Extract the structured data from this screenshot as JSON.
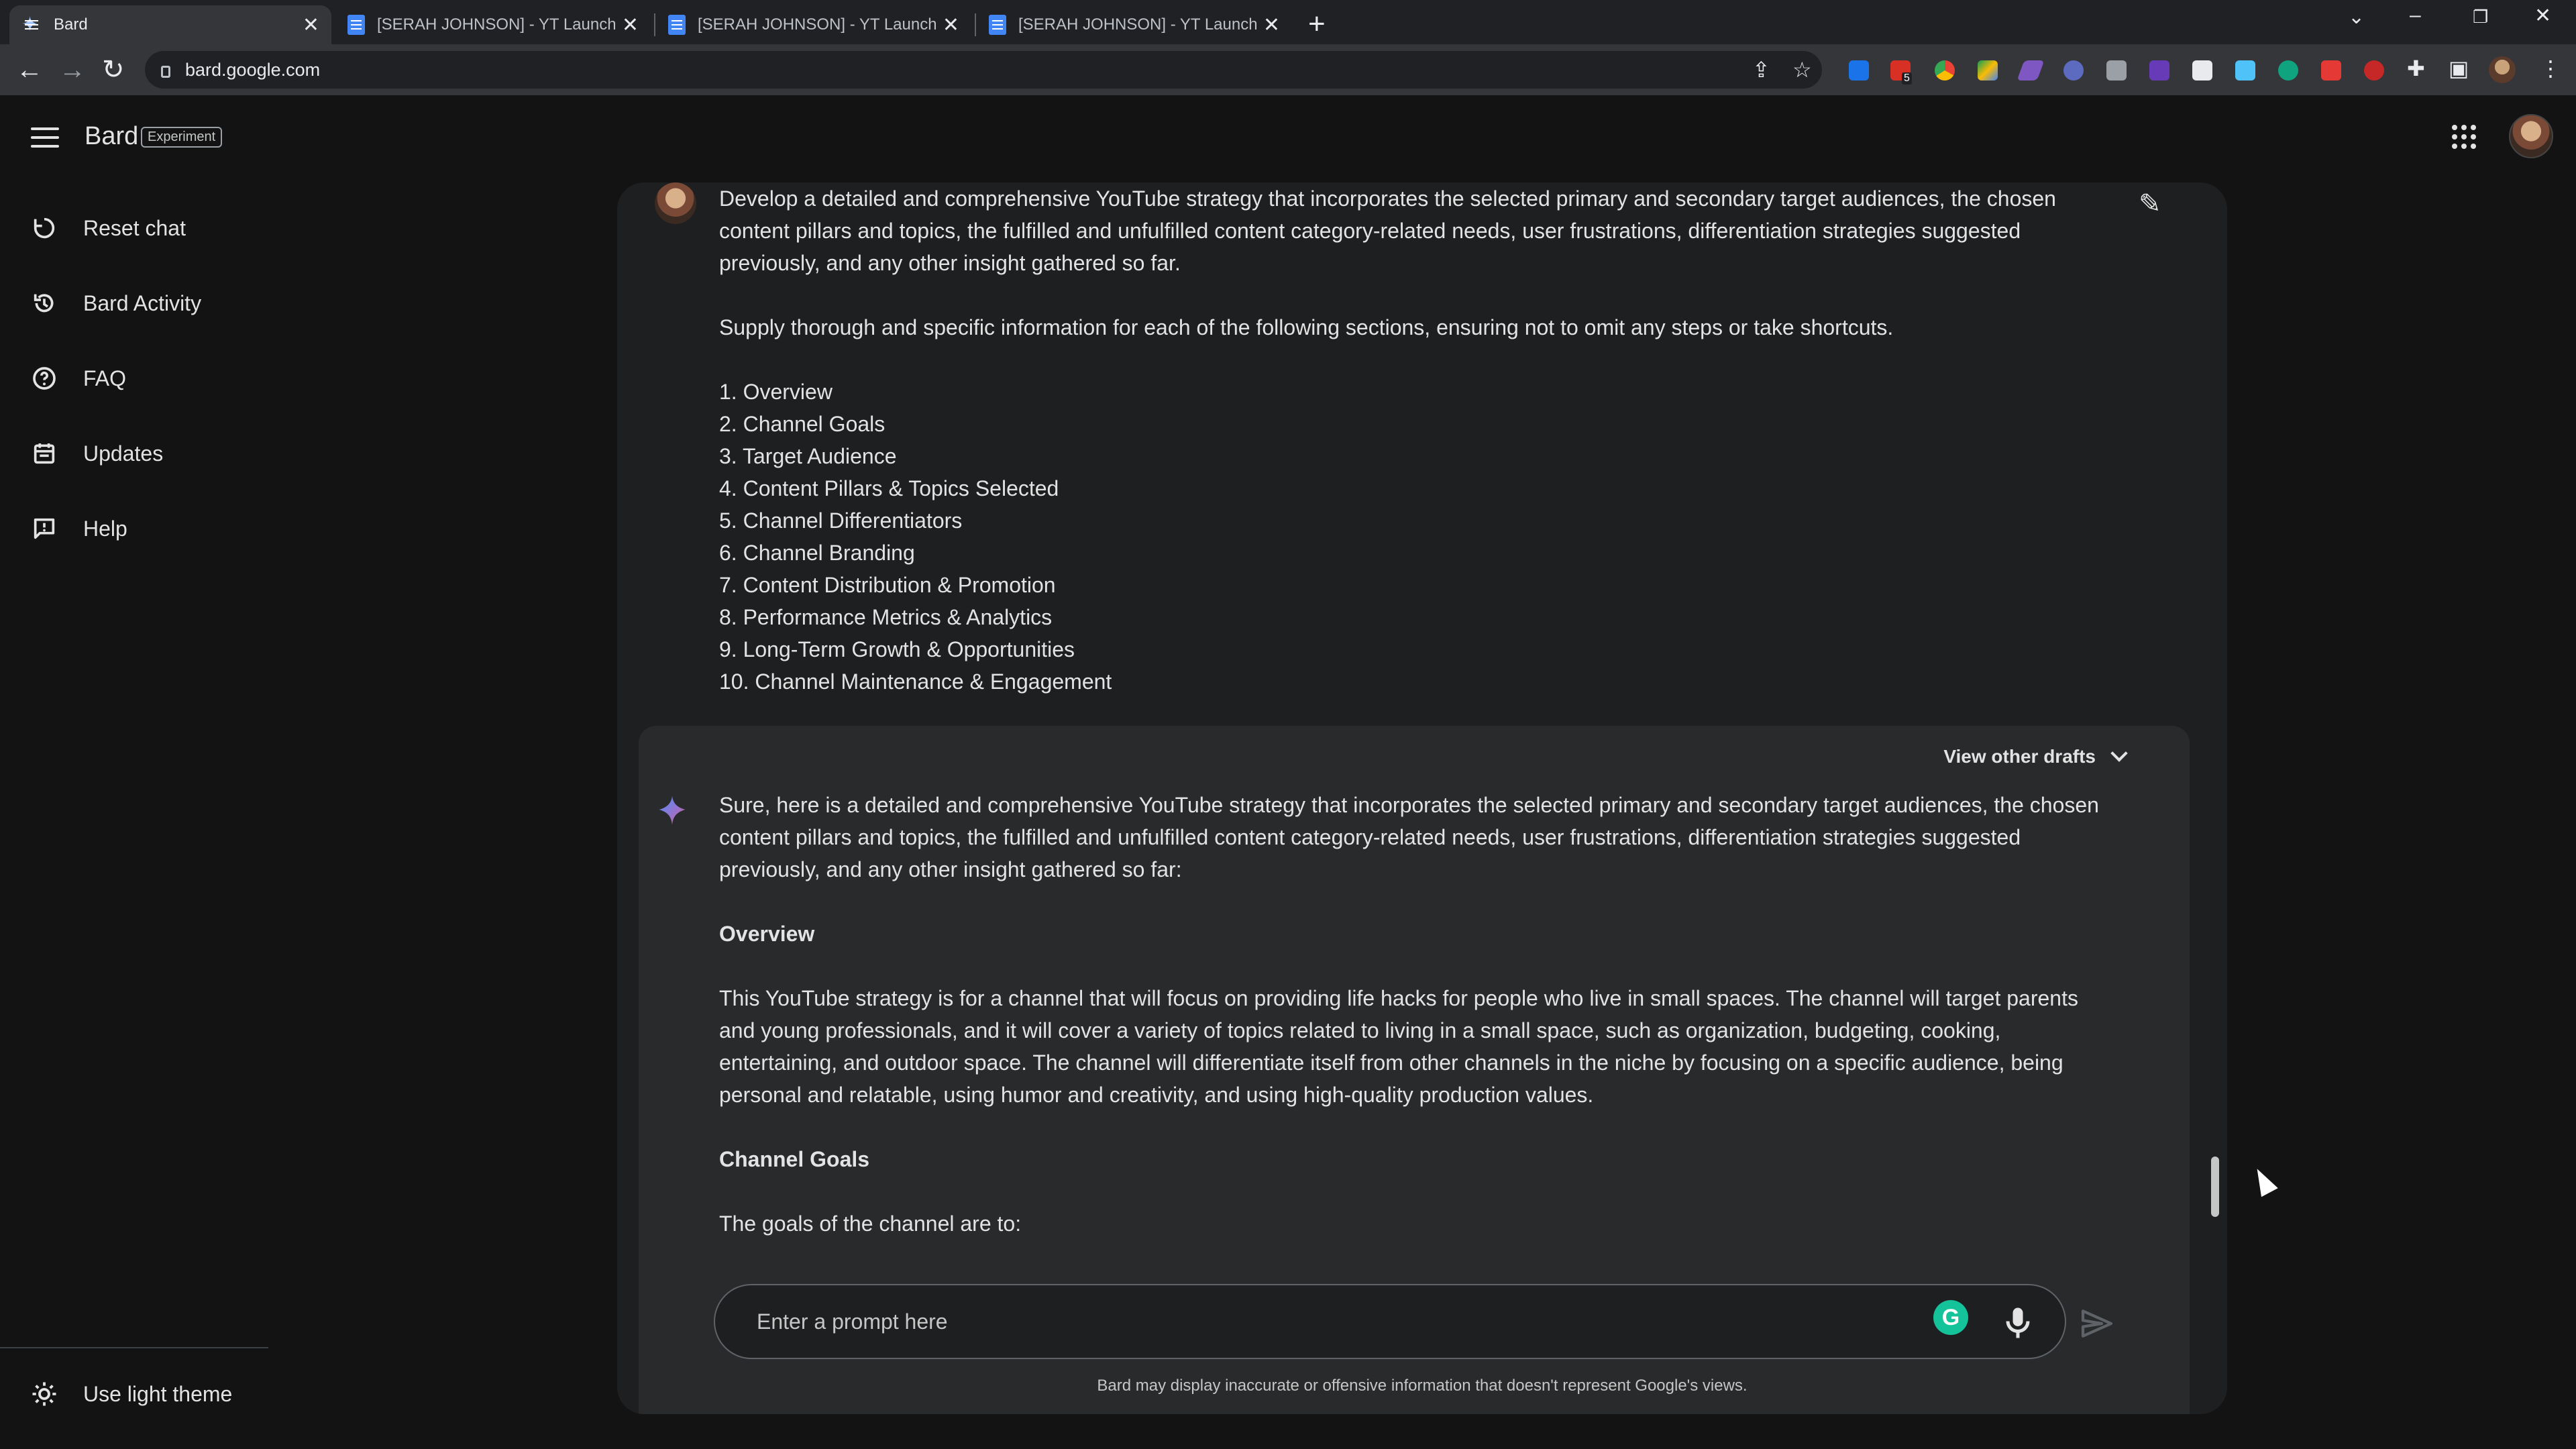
{
  "browser": {
    "tabs": [
      {
        "label": "Bard",
        "active": true
      },
      {
        "label": "[SERAH JOHNSON] - YT Launchp",
        "active": false
      },
      {
        "label": "[SERAH JOHNSON] - YT Launchp",
        "active": false
      },
      {
        "label": "[SERAH JOHNSON] - YT Launchp",
        "active": false
      }
    ],
    "url": "bard.google.com",
    "extension_badge": "5"
  },
  "app": {
    "brand": "Bard",
    "badge": "Experiment"
  },
  "sidebar": {
    "items": [
      {
        "label": "Reset chat",
        "icon": "reset-icon"
      },
      {
        "label": "Bard Activity",
        "icon": "history-icon"
      },
      {
        "label": "FAQ",
        "icon": "help-circle-icon"
      },
      {
        "label": "Updates",
        "icon": "calendar-icon"
      },
      {
        "label": "Help",
        "icon": "feedback-icon"
      }
    ],
    "theme_toggle": "Use light theme"
  },
  "chat": {
    "user_prompt": {
      "intro": "Develop a detailed and comprehensive YouTube strategy that incorporates the selected primary and secondary target audiences, the chosen content pillars and topics, the fulfilled and unfulfilled content category-related needs, user frustrations, differentiation strategies suggested previously, and any other insight gathered so far.",
      "instruction": "Supply thorough and specific information for each of the following sections, ensuring not to omit any steps or take shortcuts.",
      "sections": [
        "1. Overview",
        "2. Channel Goals",
        "3. Target Audience",
        "4. Content Pillars & Topics Selected",
        "5. Channel Differentiators",
        "6. Channel Branding",
        "7. Content Distribution & Promotion",
        "8. Performance Metrics & Analytics",
        "9. Long-Term Growth & Opportunities",
        "10. Channel Maintenance & Engagement"
      ]
    },
    "response": {
      "drafts_label": "View other drafts",
      "intro": "Sure, here is a detailed and comprehensive YouTube strategy that incorporates the selected primary and secondary target audiences, the chosen content pillars and topics, the fulfilled and unfulfilled content category-related needs, user frustrations, differentiation strategies suggested previously, and any other insight gathered so far:",
      "overview_heading": "Overview",
      "overview_text": "This YouTube strategy is for a channel that will focus on providing life hacks for people who live in small spaces. The channel will target parents and young professionals, and it will cover a variety of topics related to living in a small space, such as organization, budgeting, cooking, entertaining, and outdoor space. The channel will differentiate itself from other channels in the niche by focusing on a specific audience, being personal and relatable, using humor and creativity, and using high-quality production values.",
      "goals_heading": "Channel Goals",
      "goals_text": "The goals of the channel are to:"
    }
  },
  "input": {
    "placeholder": "Enter a prompt here"
  },
  "disclaimer": "Bard may display inaccurate or offensive information that doesn't represent Google's views.",
  "colors": {
    "background": "#131314",
    "chat_surface": "#1e1f20",
    "response_surface": "#282a2c",
    "text": "#e3e3e3",
    "accent": "#4285f4"
  }
}
